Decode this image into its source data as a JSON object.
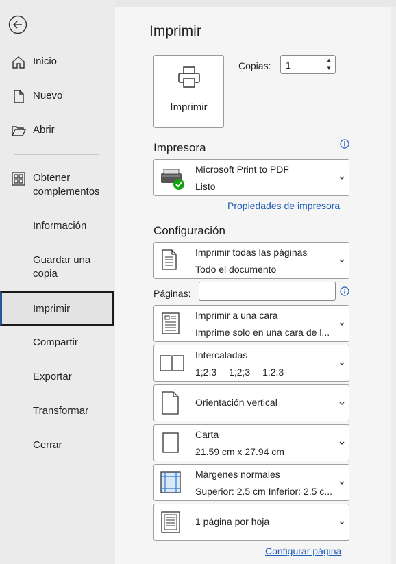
{
  "sidebar": {
    "items": [
      {
        "label": "Inicio",
        "icon": "home-icon"
      },
      {
        "label": "Nuevo",
        "icon": "new-document-icon"
      },
      {
        "label": "Abrir",
        "icon": "folder-open-icon"
      },
      {
        "label": "Obtener complementos",
        "icon": "addins-grid-icon"
      },
      {
        "label": "Información"
      },
      {
        "label": "Guardar una copia"
      },
      {
        "label": "Imprimir",
        "active": true
      },
      {
        "label": "Compartir"
      },
      {
        "label": "Exportar"
      },
      {
        "label": "Transformar"
      },
      {
        "label": "Cerrar"
      }
    ]
  },
  "main": {
    "title": "Imprimir",
    "print_button": "Imprimir",
    "copies_label": "Copias:",
    "copies_value": "1",
    "printer_section": "Impresora",
    "printer": {
      "name": "Microsoft Print to PDF",
      "status": "Listo"
    },
    "printer_properties_link": "Propiedades de impresora",
    "config_section": "Configuración",
    "pages_label": "Páginas:",
    "pages_value": "",
    "settings": [
      {
        "line1": "Imprimir todas las páginas",
        "line2": "Todo el documento",
        "icon": "pages-icon"
      },
      {
        "line1": "Imprimir a una cara",
        "line2": "Imprime solo en una cara de l...",
        "icon": "one-sided-icon"
      },
      {
        "line1": "Intercaladas",
        "line2a": "1;2;3",
        "line2b": "1;2;3",
        "line2c": "1;2;3",
        "icon": "collated-icon"
      },
      {
        "line1": "Orientación vertical",
        "icon": "portrait-icon"
      },
      {
        "line1": "Carta",
        "line2": "21.59 cm x 27.94 cm",
        "icon": "paper-size-icon"
      },
      {
        "line1": "Márgenes normales",
        "line2": "Superior: 2.5 cm Inferior: 2.5 c...",
        "icon": "margins-icon"
      },
      {
        "line1": "1 página por hoja",
        "icon": "pages-per-sheet-icon"
      }
    ],
    "page_setup_link": "Configurar página"
  },
  "colors": {
    "accent": "#2b579a",
    "link": "#1f5db8",
    "printer_ok": "#13a10e"
  }
}
